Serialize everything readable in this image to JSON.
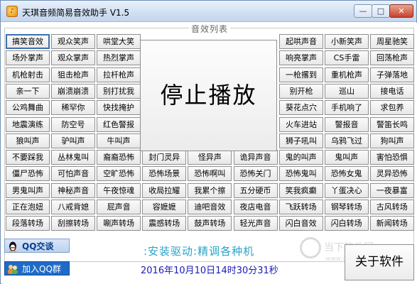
{
  "window": {
    "title": "天琪音频简易音效助手 V1.5",
    "icon_name": "app-sound-icon",
    "minimize": "—",
    "maximize": "□",
    "close": "✕"
  },
  "group": {
    "title": "音效列表"
  },
  "stop_label": "停止播放",
  "left_rows": [
    [
      "搞笑音效",
      "观众笑声",
      "哄堂大笑"
    ],
    [
      "场外掌声",
      "观众掌声",
      "热烈掌声"
    ],
    [
      "机枪射击",
      "狙击枪声",
      "拉杆枪声"
    ],
    [
      "亲一下",
      "崩溃崩溃",
      "别打扰我"
    ],
    [
      "公鸡舞曲",
      "稀罕你",
      "快找掩护"
    ],
    [
      "地震演练",
      "防空号",
      "红色警报"
    ],
    [
      "狼叫声",
      "驴叫声",
      "牛叫声"
    ]
  ],
  "right_rows": [
    [
      "起哄声音",
      "小新笑声",
      "周星驰笑"
    ],
    [
      "响亮掌声",
      "CS手雷",
      "回荡枪声"
    ],
    [
      "一枪撂到",
      "重机枪声",
      "子弹落地"
    ],
    [
      "别开枪",
      "巡山",
      "接电话"
    ],
    [
      "葵花点穴",
      "手机响了",
      "求包养"
    ],
    [
      "火车进站",
      "警报音",
      "警笛长鸣"
    ],
    [
      "狮子吼叫",
      "乌鸦飞过",
      "狗叫声"
    ]
  ],
  "full_rows": [
    [
      "不要踩我",
      "丛林鬼叫",
      "裔裔恐怖",
      "封门灵异",
      "怪异声",
      "诡异声音",
      "鬼的叫声",
      "鬼叫声",
      "害怕恐惧"
    ],
    [
      "僵尸恐怖",
      "可怕声音",
      "空旷恐怖",
      "恐怖场景",
      "恐怖啊叫",
      "恐怖关门",
      "恐怖鬼叫",
      "恐怖女鬼",
      "灵异恐怖"
    ],
    [
      "男鬼叫声",
      "神秘声音",
      "午夜惊魂",
      "收局拉耀",
      "我累个擦",
      "五分硬币",
      "笑我疯癫",
      "丫蛋决心",
      "一夜暴富"
    ],
    [
      "正在泡妞",
      "八戒背媳",
      "屁声音",
      "容嬷嬷",
      "迪吧音效",
      "夜店电音",
      "飞跃转场",
      "钢琴转场",
      "古风转场"
    ],
    [
      "段落转场",
      "刮擦转场",
      "唰声转场",
      "震感转场",
      "鼓声转场",
      "轻光声音",
      "闪白音效",
      "闪白转场",
      "新闻转场"
    ]
  ],
  "qq_chat": {
    "label": "QQ交谈",
    "icon_name": "qq-penguin-icon"
  },
  "qq_group": {
    "label": "加入QQ群",
    "icon_name": "qq-group-icon"
  },
  "driver_note": ":安装驱动:精调各种机",
  "datetime": "2016年10月10日14时30分31秒",
  "about_label": "关于软件",
  "watermark": {
    "text": "当下软件园",
    "url": "www.downxia.com"
  }
}
